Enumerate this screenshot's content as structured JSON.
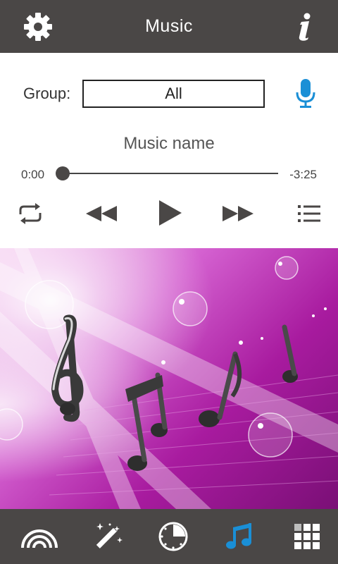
{
  "header": {
    "title": "Music",
    "left_icon": "gear-icon",
    "right_icon": "info-icon"
  },
  "group": {
    "label": "Group:",
    "selected": "All",
    "mic_icon": "microphone-icon"
  },
  "player": {
    "track_name": "Music name",
    "elapsed": "0:00",
    "remaining": "-3:25",
    "progress": 0.0,
    "controls": [
      "repeat-icon",
      "rewind-icon",
      "play-icon",
      "fast-forward-icon",
      "playlist-icon"
    ]
  },
  "tabs": [
    {
      "name": "rainbow-icon",
      "active": false
    },
    {
      "name": "magic-wand-icon",
      "active": false
    },
    {
      "name": "timer-icon",
      "active": false
    },
    {
      "name": "music-note-icon",
      "active": true
    },
    {
      "name": "grid-icon",
      "active": false
    }
  ],
  "colors": {
    "header_bg": "#4a4746",
    "accent": "#1a8fd6",
    "icon_dark": "#4a4746"
  }
}
